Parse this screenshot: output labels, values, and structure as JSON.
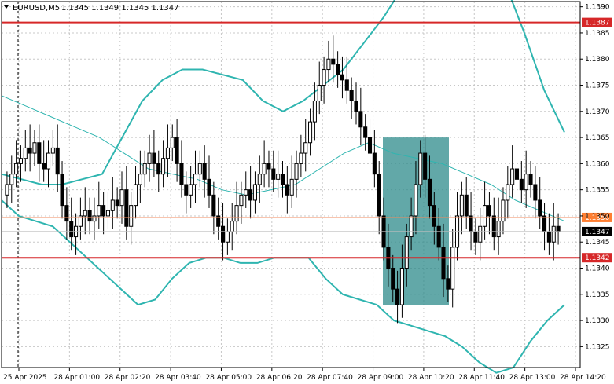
{
  "header": {
    "symbol_label": "EURUSD,M5",
    "ohlc": "1.1345 1.1349 1.1345 1.1347",
    "dropdown_icon": "triangle-down-icon"
  },
  "colors": {
    "background": "#ffffff",
    "grid": "#c8c8c8",
    "candle": "#000000",
    "bollinger": "#2fb5b0",
    "moving_average": "#2fb5b0",
    "level_line": "#d62728",
    "level_line_light": "#f08a5d",
    "highlight_box": "#2e8b8b",
    "current_price_tag": "#000000"
  },
  "chart_data": {
    "type": "candlestick",
    "title": "EURUSD,M5",
    "ylim": [
      1.1321,
      1.1391
    ],
    "y_ticks": [
      "1.1390",
      "1.1385",
      "1.1380",
      "1.1375",
      "1.1370",
      "1.1365",
      "1.1360",
      "1.1355",
      "1.1350",
      "1.1345",
      "1.1340",
      "1.1335",
      "1.1330",
      "1.1325"
    ],
    "x_ticks": [
      "25 Apr 2025",
      "28 Apr 01:00",
      "28 Apr 02:20",
      "28 Apr 03:40",
      "28 Apr 05:00",
      "28 Apr 06:20",
      "28 Apr 07:40",
      "28 Apr 09:00",
      "28 Apr 10:20",
      "28 Apr 11:40",
      "28 Apr 13:00",
      "28 Apr 14:20"
    ],
    "grid": true,
    "horizontal_levels": [
      {
        "label": "1.1387",
        "value": 1.1387,
        "style": "red-tag"
      },
      {
        "label": "1.1350",
        "value": 1.13497,
        "style": "orange-tag"
      },
      {
        "label": "1.1347",
        "value": 1.1347,
        "style": "black-tag"
      },
      {
        "label": "1.1342",
        "value": 1.1342,
        "style": "red-tag"
      }
    ],
    "highlight_zone": {
      "from_time": "28 Apr 09:10",
      "to_time": "28 Apr 10:25",
      "price_low": 1.1333,
      "price_high": 1.1365
    },
    "closes": [
      1.1356,
      1.1358,
      1.136,
      1.1361,
      1.1363,
      1.1362,
      1.1364,
      1.136,
      1.1359,
      1.1362,
      1.1363,
      1.1358,
      1.1352,
      1.1349,
      1.1346,
      1.1348,
      1.135,
      1.1351,
      1.1349,
      1.135,
      1.1352,
      1.135,
      1.1351,
      1.1353,
      1.1352,
      1.1355,
      1.1348,
      1.1352,
      1.1356,
      1.1358,
      1.136,
      1.1362,
      1.136,
      1.1358,
      1.1361,
      1.1363,
      1.1365,
      1.136,
      1.1356,
      1.1354,
      1.1356,
      1.1358,
      1.136,
      1.1357,
      1.1354,
      1.135,
      1.1348,
      1.1345,
      1.1347,
      1.1349,
      1.1352,
      1.1354,
      1.1355,
      1.1353,
      1.1356,
      1.1358,
      1.136,
      1.1359,
      1.1357,
      1.1358,
      1.1356,
      1.1354,
      1.1357,
      1.136,
      1.1362,
      1.1364,
      1.1368,
      1.1372,
      1.1375,
      1.1378,
      1.138,
      1.1379,
      1.1377,
      1.1376,
      1.1374,
      1.1372,
      1.137,
      1.1367,
      1.1365,
      1.1362,
      1.1358,
      1.135,
      1.1344,
      1.134,
      1.1336,
      1.1333,
      1.134,
      1.1346,
      1.135,
      1.1356,
      1.1362,
      1.1357,
      1.1352,
      1.1348,
      1.1344,
      1.1338,
      1.1336,
      1.1344,
      1.135,
      1.1354,
      1.135,
      1.1347,
      1.1345,
      1.1348,
      1.1352,
      1.135,
      1.1346,
      1.1349,
      1.1353,
      1.1356,
      1.1359,
      1.1357,
      1.1355,
      1.1358,
      1.1356,
      1.1353,
      1.135,
      1.1347,
      1.1345,
      1.1348,
      1.1347
    ],
    "bollinger_upper": [
      1.1358,
      1.1357,
      1.1356,
      1.1356,
      1.1357,
      1.1358,
      1.1365,
      1.1372,
      1.1376,
      1.1378,
      1.1378,
      1.1377,
      1.1376,
      1.1372,
      1.137,
      1.1372,
      1.1375,
      1.1378,
      1.1383,
      1.1388,
      1.1394,
      1.14,
      1.1405,
      1.1408,
      1.1403,
      1.1395,
      1.1385,
      1.1374,
      1.1366
    ],
    "bollinger_lower": [
      1.1353,
      1.135,
      1.1349,
      1.1348,
      1.1345,
      1.1342,
      1.1339,
      1.1336,
      1.1333,
      1.1334,
      1.1338,
      1.1341,
      1.1342,
      1.1342,
      1.1341,
      1.1341,
      1.1342,
      1.1342,
      1.1342,
      1.1338,
      1.1335,
      1.1334,
      1.1333,
      1.133,
      1.1329,
      1.1328,
      1.1327,
      1.1325,
      1.1322,
      1.132,
      1.1321,
      1.1326,
      1.133,
      1.1333
    ],
    "moving_average": [
      1.1373,
      1.1371,
      1.1369,
      1.1367,
      1.1365,
      1.1362,
      1.1359,
      1.1358,
      1.1357,
      1.1355,
      1.1354,
      1.1355,
      1.1356,
      1.1359,
      1.1362,
      1.1364,
      1.1362,
      1.1361,
      1.136,
      1.1358,
      1.1356,
      1.1353,
      1.1351,
      1.1349
    ]
  }
}
